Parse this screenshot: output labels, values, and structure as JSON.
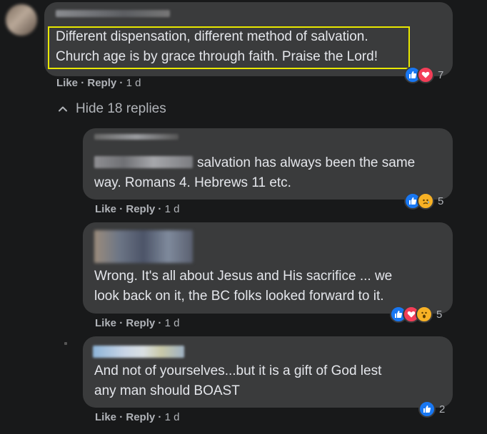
{
  "thread": {
    "toggle_label": "Hide 18 replies"
  },
  "comments": [
    {
      "text_lines": [
        "Different dispensation, different method of salvation.",
        "Church age is by grace through faith. Praise the Lord!"
      ],
      "like_label": "Like",
      "reply_label": "Reply",
      "time": "1 d",
      "reaction_icons": [
        "like-icon",
        "love-icon"
      ],
      "reaction_count": "7",
      "highlighted": true
    },
    {
      "text_lines": [
        "salvation has always been the same",
        "way. Romans 4. Hebrews 11 etc."
      ],
      "like_label": "Like",
      "reply_label": "Reply",
      "time": "1 d",
      "reaction_icons": [
        "like-icon",
        "sad-icon"
      ],
      "reaction_count": "5"
    },
    {
      "text_lines": [
        "Wrong. It's all about Jesus and His sacrifice ... we",
        "look back on it, the BC folks looked forward to it."
      ],
      "like_label": "Like",
      "reply_label": "Reply",
      "time": "1 d",
      "reaction_icons": [
        "like-icon",
        "love-icon",
        "wow-icon"
      ],
      "reaction_count": "5"
    },
    {
      "text_lines": [
        "And not of yourselves...but it is a gift of God lest",
        "any man should BOAST"
      ],
      "like_label": "Like",
      "reply_label": "Reply",
      "time": "1 d",
      "reaction_icons": [
        "like-icon"
      ],
      "reaction_count": "2"
    }
  ],
  "colors": {
    "background": "#18191a",
    "bubble": "#3a3b3c",
    "highlight_border": "#e8e800",
    "like_blue": "#1877f2",
    "love_red": "#f33e58",
    "wow_yellow": "#f7b125"
  }
}
